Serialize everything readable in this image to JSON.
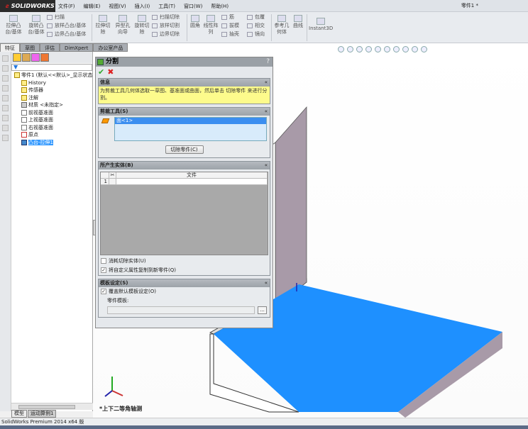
{
  "app": {
    "logo": "SOLIDWORKS",
    "doc_title": "零件1 *"
  },
  "menu": [
    "文件(F)",
    "编辑(E)",
    "视图(V)",
    "插入(I)",
    "工具(T)",
    "窗口(W)",
    "帮助(H)"
  ],
  "ribbon": {
    "big": [
      "拉伸凸台/基体",
      "旋转凸台/基体",
      "拉伸切除",
      "异型孔向导",
      "旋转切除",
      "圆角",
      "线性阵列",
      "参考几何体",
      "曲线",
      "Instant3D"
    ],
    "small": [
      "扫描",
      "放样凸台/基体",
      "边界凸台/基体",
      "扫描切除",
      "放样切割",
      "边界切除",
      "筋",
      "拔模",
      "抽壳",
      "包覆",
      "相交",
      "镜向"
    ]
  },
  "command_tabs": [
    "特征",
    "草图",
    "评估",
    "DimXpert",
    "办公室产品"
  ],
  "tree": {
    "root": "零件1 (默认<<默认>_显示状态",
    "items": [
      "History",
      "传感器",
      "注解",
      "材质 <未指定>",
      "前视基准面",
      "上视基准面",
      "右视基准面",
      "原点",
      "凸台-拉伸1"
    ]
  },
  "bottom_tabs": [
    "模型",
    "运动算例1"
  ],
  "status": "SolidWorks Premium 2014 x64 版",
  "view_name": "*上下二等角轴测",
  "pm": {
    "title": "分割",
    "help": "?",
    "ok": "✔",
    "cancel": "✖",
    "info_title": "信息",
    "info_text": "为剪裁工具几何体选取一草图、基准面或曲面，然后单击 切除零件 来进行分割。",
    "trim_title": "剪裁工具(S)",
    "trim_item": "面<1>",
    "cut_button": "切除零件(C)",
    "bodies_title": "所产生实体(B)",
    "col_file": "文件",
    "row1": "1",
    "consume": "消耗切除实体(U)",
    "copy_props": "将自定义属性复制到新零件(Q)",
    "template_title": "模板设定(S)",
    "override": "覆盖默认模板设定(O)",
    "part_template": "零件模板:",
    "browse": "...",
    "collapse": "«"
  },
  "colors": {
    "face": "#1e90ff",
    "wall": "#a89aa8"
  }
}
